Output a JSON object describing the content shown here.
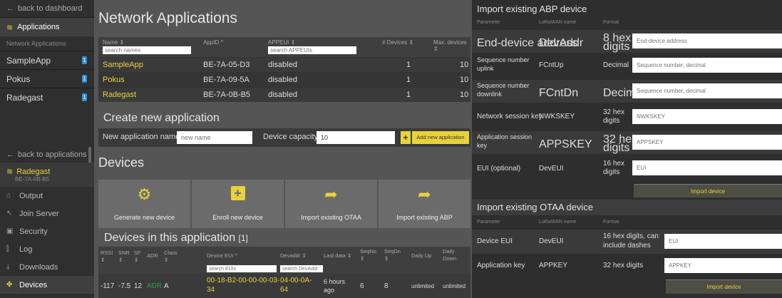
{
  "sidebar": {
    "back_dashboard": "back to dashboard",
    "applications": "Applications",
    "section_label": "Network Applications",
    "apps": [
      {
        "name": "SampleApp",
        "badge": "1"
      },
      {
        "name": "Pokus",
        "badge": "1"
      },
      {
        "name": "Radegast",
        "badge": "1"
      }
    ],
    "back_applications": "back to applications",
    "current_app": {
      "name": "Radegast",
      "id": "BE-7A-0B-B5"
    },
    "menu": [
      {
        "label": "Output",
        "icon": "output-icon"
      },
      {
        "label": "Join Server",
        "icon": "join-icon"
      },
      {
        "label": "Security",
        "icon": "lock-icon"
      },
      {
        "label": "Log",
        "icon": "log-icon"
      },
      {
        "label": "Downloads",
        "icon": "download-icon"
      },
      {
        "label": "Devices",
        "icon": "devices-icon"
      }
    ]
  },
  "network_apps": {
    "title": "Network Applications",
    "columns": {
      "name": "Name ⇕",
      "appid": "AppID ^",
      "appeui": "APPEUI ⇕",
      "devices": "# Devices ⇕",
      "max": "Max. devices ⇕"
    },
    "search_names_placeholder": "search names",
    "search_appeuis_placeholder": "search APPEUIs",
    "rows": [
      {
        "name": "SampleApp",
        "appid": "BE-7A-05-D3",
        "appeui": "disabled",
        "devices": "1",
        "max": "10"
      },
      {
        "name": "Pokus",
        "appid": "BE-7A-09-5A",
        "appeui": "disabled",
        "devices": "1",
        "max": "10"
      },
      {
        "name": "Radegast",
        "appid": "BE-7A-0B-B5",
        "appeui": "disabled",
        "devices": "1",
        "max": "10"
      }
    ]
  },
  "create_app": {
    "title": "Create new application",
    "name_label": "New application name",
    "name_placeholder": "new name",
    "capacity_label": "Device capacity",
    "capacity_value": "10",
    "plus": "+",
    "add_button": "Add new application"
  },
  "devices": {
    "title": "Devices",
    "tiles": [
      {
        "label": "Generate new device",
        "icon": "gears-icon"
      },
      {
        "label": "Enroll new device",
        "icon": "plus-box-icon"
      },
      {
        "label": "Import existing OTAA",
        "icon": "share-arrow-icon"
      },
      {
        "label": "Import existing ABP",
        "icon": "share-arrow-icon"
      }
    ]
  },
  "devices_in_app": {
    "title": "Devices in this application",
    "count": "[1]",
    "columns": {
      "rssi": "RSSI",
      "rssi2": "⇕",
      "snr": "SNR",
      "snr2": "⇕",
      "sf": "SF",
      "sf2": "⇕",
      "adr": "ADR",
      "class": "Class",
      "class2": "⇕",
      "deveui": "Device EUI ^",
      "devaddr": "Devaddr ⇕",
      "lastdata": "Last data ⇕",
      "seqno": "SeqNo",
      "seqno2": "⇕",
      "seqdn": "SeqDn",
      "seqdn2": "⇕",
      "dailyup": "Daily Up",
      "dailydown": "Daily",
      "dailydown2": "Down"
    },
    "search_euis_placeholder": "search EUIs",
    "search_devaddr_placeholder": "search DevAddr",
    "row": {
      "rssi": "-117",
      "snr": "-7.5",
      "sf": "12",
      "adr": "ADR",
      "class": "A",
      "deveui1": "00-18-B2-00-00-00-03-",
      "deveui2": "34",
      "devaddr1": "04-00-0A-",
      "devaddr2": "64",
      "lastdata1": "6 hours",
      "lastdata2": "ago",
      "seqno": "6",
      "seqdn": "8",
      "dailyup": "unlimited",
      "dailydown": "unlimited"
    }
  },
  "abp": {
    "title": "Import existing ABP device",
    "headers": {
      "parameter": "Parameter",
      "lorawan": "LoRaWAN name",
      "format": "Format"
    },
    "rows": [
      {
        "param": "End-device address",
        "name": "DevAddr",
        "format1": "8 hex",
        "format2": "digits",
        "placeholder": "End-device address"
      },
      {
        "param1": "Sequence number",
        "param2": "uplink",
        "name": "FCntUp",
        "format": "Decimal",
        "placeholder": "Sequence number, decimal"
      },
      {
        "param1": "Sequence number",
        "param2": "downlink",
        "name": "FCntDn",
        "format": "Decimal",
        "placeholder": "Sequence number, decimal"
      },
      {
        "param": "Network session key",
        "name": "NWKSKEY",
        "format1": "32 hex",
        "format2": "digits",
        "placeholder": "NWKSKEY"
      },
      {
        "param1": "Application session",
        "param2": "key",
        "name": "APPSKEY",
        "format1": "32 hex",
        "format2": "digits",
        "placeholder": "APPSKEY"
      },
      {
        "param": "EUI (optional)",
        "name": "DevEUI",
        "format1": "16 hex",
        "format2": "digits",
        "placeholder": "EUI"
      }
    ],
    "button": "Import device"
  },
  "otaa": {
    "title": "Import existing OTAA device",
    "headers": {
      "parameter": "Parameter",
      "lorawan": "LoRaWAN name",
      "format": "Format"
    },
    "rows": [
      {
        "param": "Device EUI",
        "name": "DevEUI",
        "format1": "16 hex digits, can",
        "format2": "include dashes",
        "placeholder": "EUI"
      },
      {
        "param": "Application key",
        "name": "APPKEY",
        "format": "32 hex digits",
        "placeholder": "APPKEY"
      }
    ],
    "button": "Import device"
  },
  "colors": {
    "accent": "#e8d23a",
    "badge": "#2f8fd6",
    "adr": "#2f9a3a"
  }
}
